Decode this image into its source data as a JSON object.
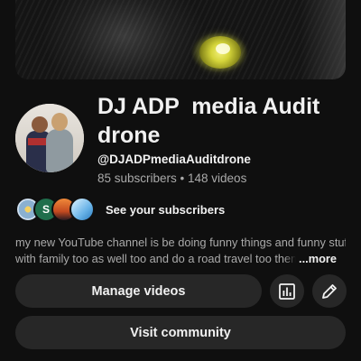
{
  "channel": {
    "name": "DJ ADP  media Audit drone",
    "handle": "@DJADPmediaAuditdrone",
    "stats": "85 subscribers • 148 videos",
    "banner_icon": "cat-eye-banner",
    "avatar_icon": "profile-photo"
  },
  "subscribers": {
    "label": "See your subscribers",
    "avatars": [
      "subscriber-avatar-1",
      "S",
      "subscriber-avatar-3",
      "subscriber-avatar-4"
    ]
  },
  "description": {
    "line1": "my new YouTube channel is be doing funny things and funny stuff",
    "line2": "with family too as well too and do a road travel too them",
    "more_label": "...more"
  },
  "actions": {
    "manage_label": "Manage videos",
    "analytics_icon": "analytics-icon",
    "edit_icon": "pencil-icon",
    "community_label": "Visit community"
  },
  "colors": {
    "background": "#0f0f0f",
    "button": "#272727",
    "text": "#f1f1f1",
    "secondary_text": "#aaaaaa"
  }
}
